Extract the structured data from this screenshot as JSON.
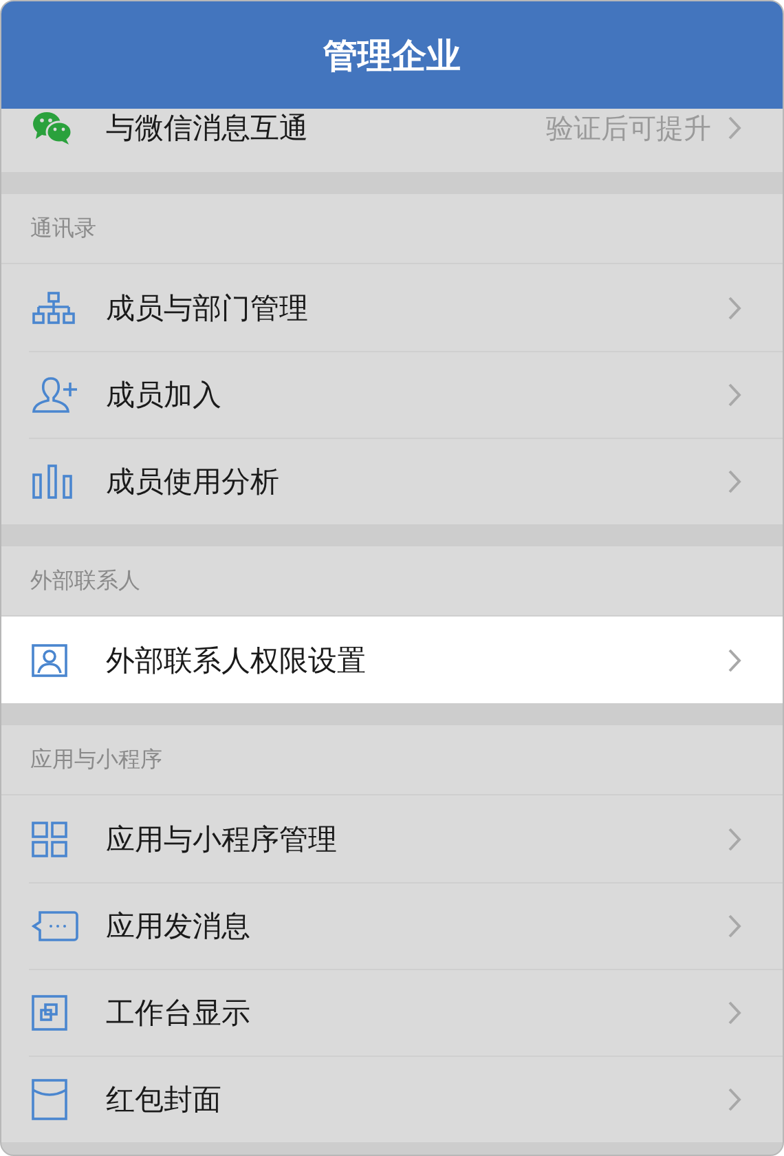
{
  "header": {
    "title": "管理企业"
  },
  "top_item": {
    "label": "与微信消息互通",
    "kind": "wechat",
    "value": "验证后可提升"
  },
  "sections": [
    {
      "title": "通讯录",
      "items": [
        {
          "label": "成员与部门管理",
          "kind": "org",
          "highlighted": false
        },
        {
          "label": "成员加入",
          "kind": "user-add",
          "highlighted": false
        },
        {
          "label": "成员使用分析",
          "kind": "bars",
          "highlighted": false
        }
      ]
    },
    {
      "title": "外部联系人",
      "items": [
        {
          "label": "外部联系人权限设置",
          "kind": "contact-card",
          "highlighted": true
        }
      ]
    },
    {
      "title": "应用与小程序",
      "items": [
        {
          "label": "应用与小程序管理",
          "kind": "grid",
          "highlighted": false
        },
        {
          "label": "应用发消息",
          "kind": "message",
          "highlighted": false
        },
        {
          "label": "工作台显示",
          "kind": "window",
          "highlighted": false
        },
        {
          "label": "红包封面",
          "kind": "envelope",
          "highlighted": false
        }
      ]
    }
  ]
}
